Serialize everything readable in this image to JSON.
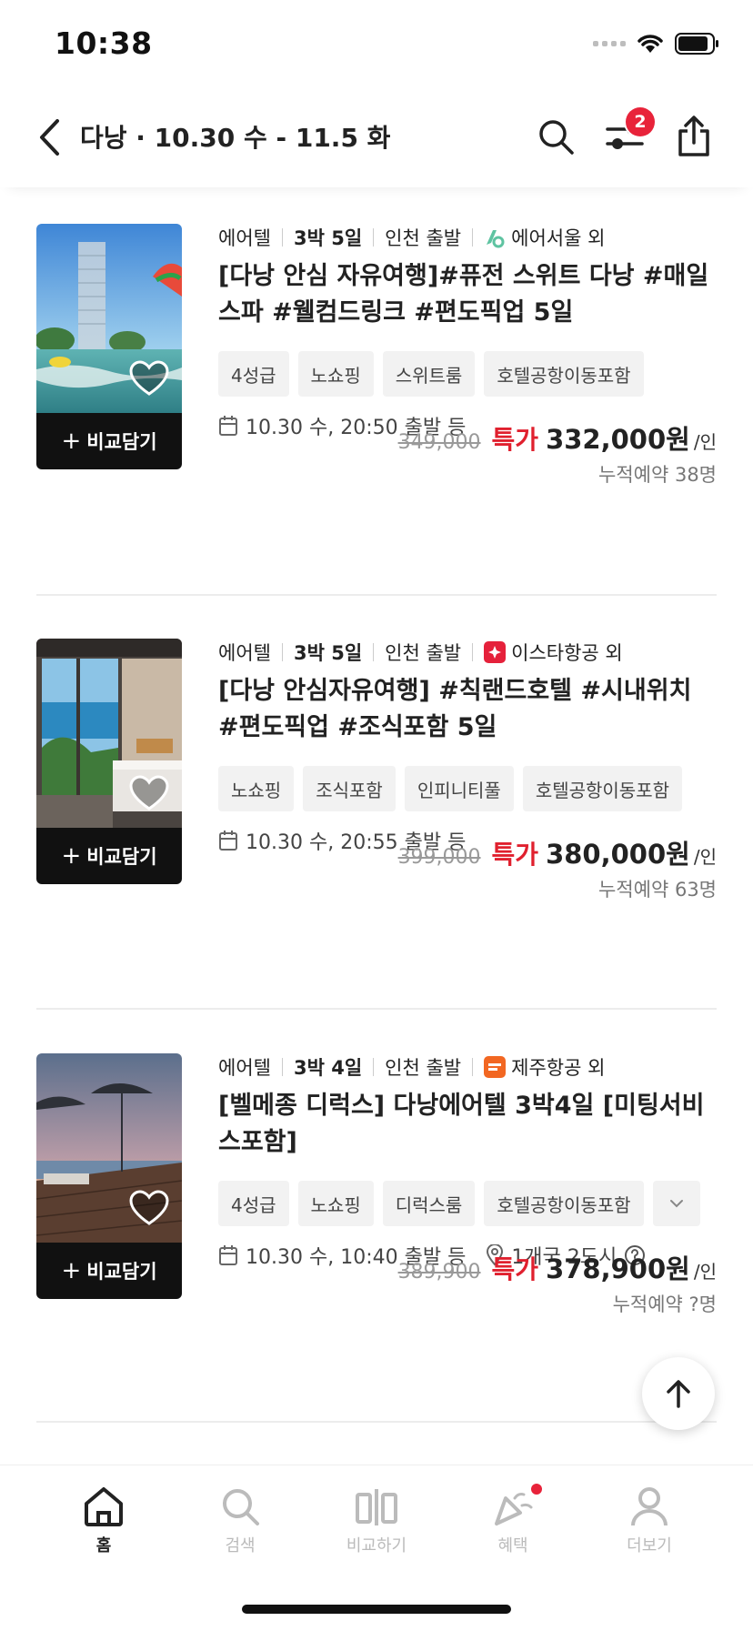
{
  "status_bar": {
    "time": "10:38"
  },
  "header": {
    "title": "다낭 · 10.30 수 - 11.5 화",
    "filter_badge": "2"
  },
  "products": [
    {
      "meta": {
        "category": "에어텔",
        "duration": "3박 5일",
        "departure": "인천 출발",
        "airline": "에어서울 외"
      },
      "title": "[다낭 안심 자유여행]#퓨전 스위트 다낭 #매일스파 #웰컴드링크 #편도픽업 5일",
      "tags": [
        "4성급",
        "노쇼핑",
        "스위트룸",
        "호텔공항이동포함"
      ],
      "date": "10.30 수, 20:50 출발 등",
      "price": {
        "original": "349,000",
        "special_label": "특가",
        "current": "332,000원",
        "unit": "/인"
      },
      "booked": "누적예약 38명",
      "compare_label": "비교담기"
    },
    {
      "meta": {
        "category": "에어텔",
        "duration": "3박 5일",
        "departure": "인천 출발",
        "airline": "이스타항공 외"
      },
      "title": "[다낭 안심자유여행] #칙랜드호텔 #시내위치 #편도픽업 #조식포함 5일",
      "tags": [
        "노쇼핑",
        "조식포함",
        "인피니티풀",
        "호텔공항이동포함"
      ],
      "date": "10.30 수, 20:55 출발 등",
      "price": {
        "original": "399,000",
        "special_label": "특가",
        "current": "380,000원",
        "unit": "/인"
      },
      "booked": "누적예약 63명",
      "compare_label": "비교담기"
    },
    {
      "meta": {
        "category": "에어텔",
        "duration": "3박 4일",
        "departure": "인천 출발",
        "airline": "제주항공 외"
      },
      "title": "[벨메종 디럭스] 다낭에어텔 3박4일 [미팅서비스포함]",
      "tags": [
        "4성급",
        "노쇼핑",
        "디럭스룸",
        "호텔공항이동포함"
      ],
      "date": "10.30 수, 10:40 출발 등",
      "location": "1개국 2도시",
      "price": {
        "original": "389,900",
        "special_label": "특가",
        "current": "378,900원",
        "unit": "/인"
      },
      "booked": "누적예약 ?명",
      "compare_label": "비교담기"
    }
  ],
  "bottom_nav": [
    {
      "label": "홈",
      "icon": "home-icon",
      "active": true
    },
    {
      "label": "검색",
      "icon": "search-icon"
    },
    {
      "label": "비교하기",
      "icon": "compare-icon"
    },
    {
      "label": "혜택",
      "icon": "party-icon"
    },
    {
      "label": "더보기",
      "icon": "user-icon"
    }
  ],
  "colors": {
    "accent_red": "#e0202e",
    "badge_red": "#e8233a",
    "airseoul": "#5ec3a1",
    "eastar": "#e5213b",
    "jeju": "#f26722"
  }
}
